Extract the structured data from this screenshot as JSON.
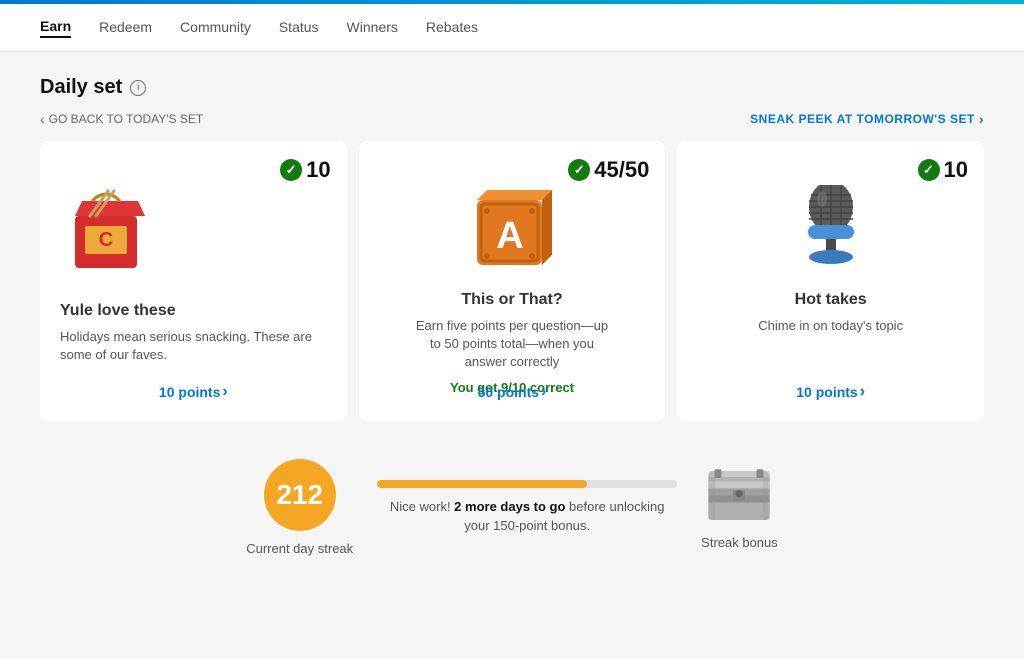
{
  "topBar": {},
  "nav": {
    "items": [
      {
        "id": "earn",
        "label": "Earn",
        "active": true
      },
      {
        "id": "redeem",
        "label": "Redeem",
        "active": false
      },
      {
        "id": "community",
        "label": "Community",
        "active": false
      },
      {
        "id": "status",
        "label": "Status",
        "active": false
      },
      {
        "id": "winners",
        "label": "Winners",
        "active": false
      },
      {
        "id": "rebates",
        "label": "Rebates",
        "active": false
      }
    ]
  },
  "page": {
    "title": "Daily set",
    "backLink": "GO BACK TO TODAY'S SET",
    "sneakPeekLink": "SNEAK PEEK AT TOMORROW'S SET"
  },
  "cards": [
    {
      "id": "yule-love",
      "score": "10",
      "title": "Yule love these",
      "description": "Holidays mean serious snacking. These are some of our faves.",
      "pointsLabel": "10 points",
      "correctText": "",
      "type": "left"
    },
    {
      "id": "this-or-that",
      "score": "45/50",
      "title": "This or That?",
      "description": "Earn five points per question—up to 50 points total—when you answer correctly",
      "pointsLabel": "50 points",
      "correctText": "You got 9/10 correct",
      "type": "center"
    },
    {
      "id": "hot-takes",
      "score": "10",
      "title": "Hot takes",
      "description": "Chime in on today's topic",
      "pointsLabel": "10 points",
      "correctText": "",
      "type": "center"
    }
  ],
  "streak": {
    "number": "212",
    "currentLabel": "Current day streak",
    "progressPercent": 70,
    "message": "Nice work! <strong>2 more days to go</strong> before unlocking your 150-point bonus.",
    "messagePlain": "Nice work!",
    "messageBold": "2 more days to go",
    "messageSuffix": "before unlocking your 150-point bonus.",
    "bonusLabel": "Streak bonus"
  }
}
